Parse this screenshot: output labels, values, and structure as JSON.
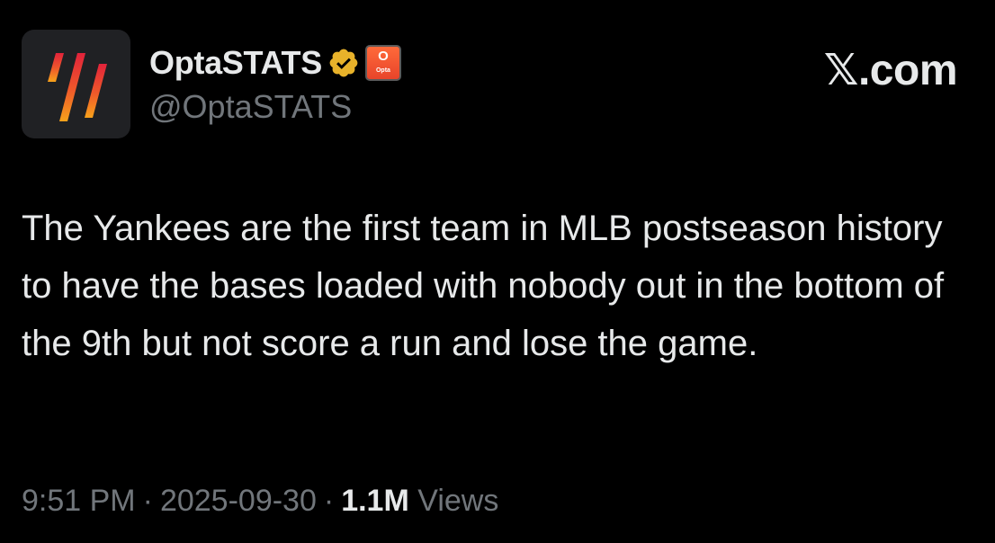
{
  "author": {
    "display_name": "OptaSTATS",
    "handle": "@OptaSTATS",
    "verified": true,
    "verified_badge_color": "#e8b22a",
    "affiliate_badge": {
      "glyph": "O",
      "text": "Opta",
      "color": "#ef5531"
    },
    "avatar_icon": "opta-logo-icon"
  },
  "brand": {
    "x_glyph": "𝕏",
    "suffix": ".com"
  },
  "tweet": {
    "text": "The Yankees are the first team in MLB postseason history to have the bases loaded with nobody out in the bottom of the 9th but not score a run and lose the game."
  },
  "meta": {
    "time": "9:51 PM",
    "separator": "·",
    "date": "2025-09-30",
    "views_count": "1.1M",
    "views_label": "Views"
  },
  "colors": {
    "background": "#000000",
    "primary_text": "#e7e9ea",
    "secondary_text": "#71767b",
    "avatar_bg": "#202124"
  }
}
